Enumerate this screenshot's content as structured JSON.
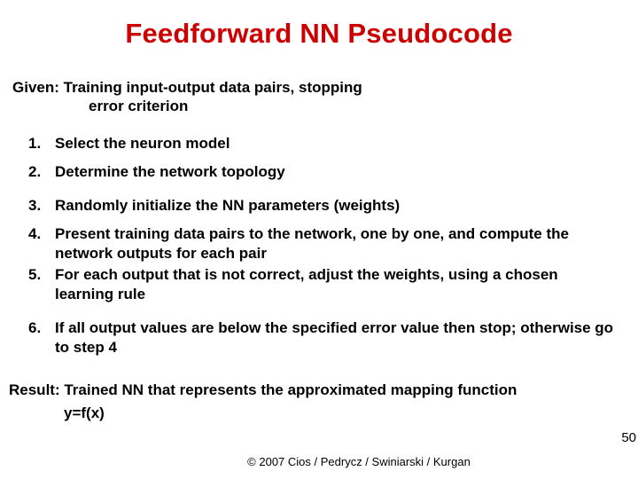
{
  "title": "Feedforward NN Pseudocode",
  "given": {
    "line1": "Given: Training input-output data pairs, stopping",
    "line2": "error criterion"
  },
  "steps": [
    {
      "n": "1.",
      "t": "Select the neuron model"
    },
    {
      "n": "2.",
      "t": "Determine the network topology"
    },
    {
      "n": "3.",
      "t": "Randomly initialize the NN parameters (weights)"
    },
    {
      "n": "4.",
      "t": "Present training data pairs to the network, one by one, and compute the network outputs for each pair"
    },
    {
      "n": "5.",
      "t": "For each output that is not correct, adjust the weights, using a chosen learning rule"
    },
    {
      "n": "6.",
      "t": "If all output values are below the specified error value then stop; otherwise go to step 4"
    }
  ],
  "result": {
    "line1": "Result: Trained NN that represents the approximated mapping function",
    "line2": "y=f(x)"
  },
  "copyright": "© 2007 Cios / Pedrycz / Swiniarski / Kurgan",
  "pagenum": "50"
}
